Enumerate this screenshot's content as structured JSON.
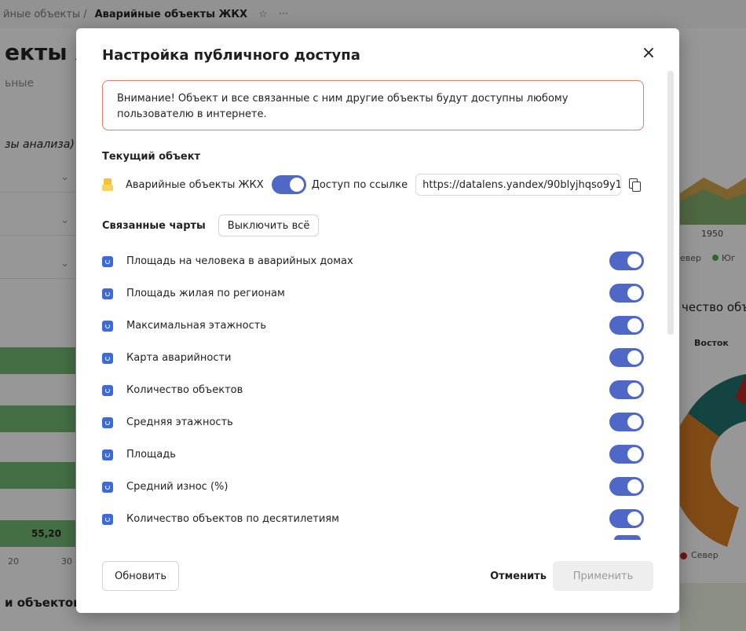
{
  "background": {
    "breadcrumb_prev": "йные объекты",
    "breadcrumb_sep": "/",
    "breadcrumb_current": "Аварийные объекты ЖКХ",
    "star": "☆",
    "dots": "···",
    "title_fragment": "екты ЖК",
    "subtitle_fragment": "ьные",
    "italic_fragment": "зы анализа)",
    "bar_value": "55,20",
    "axis_20": "20",
    "axis_30": "30",
    "bottom_fragment": "и объектов",
    "year": "1950",
    "legend_fragment_a": "евер",
    "legend_fragment_b": "Юг",
    "chart_heading_fragment": "чество объе",
    "vostok": "Восток",
    "legend2_label": "Север",
    "colors": {
      "accent": "#4f67c7",
      "warning_border": "#e77a6b",
      "bar_green": "#6fb46f"
    }
  },
  "modal": {
    "title": "Настройка публичного доступа",
    "close_icon": "×",
    "warning": "Внимание! Объект и все связанные с ним другие объекты будут доступны любому пользователю в интернете.",
    "current_section": "Текущий объект",
    "current_object": {
      "name": "Аварийные объекты ЖКХ",
      "toggle_on": true,
      "access_label": "Доступ по ссылке",
      "url": "https://datalens.yandex/90blyjhqso9y1"
    },
    "linked_section": "Связанные чарты",
    "disable_all": "Выключить всё",
    "charts": [
      {
        "label": "Площадь на человека в аварийных домах",
        "on": true
      },
      {
        "label": "Площадь жилая по регионам",
        "on": true
      },
      {
        "label": "Максимальная этажность",
        "on": true
      },
      {
        "label": "Карта аварийности",
        "on": true
      },
      {
        "label": "Количество объектов",
        "on": true
      },
      {
        "label": "Средняя этажность",
        "on": true
      },
      {
        "label": "Площадь",
        "on": true
      },
      {
        "label": "Средний износ (%)",
        "on": true
      },
      {
        "label": "Количество объектов по десятилетиям",
        "on": true
      }
    ],
    "footer": {
      "refresh": "Обновить",
      "cancel": "Отменить",
      "apply": "Применить"
    }
  }
}
